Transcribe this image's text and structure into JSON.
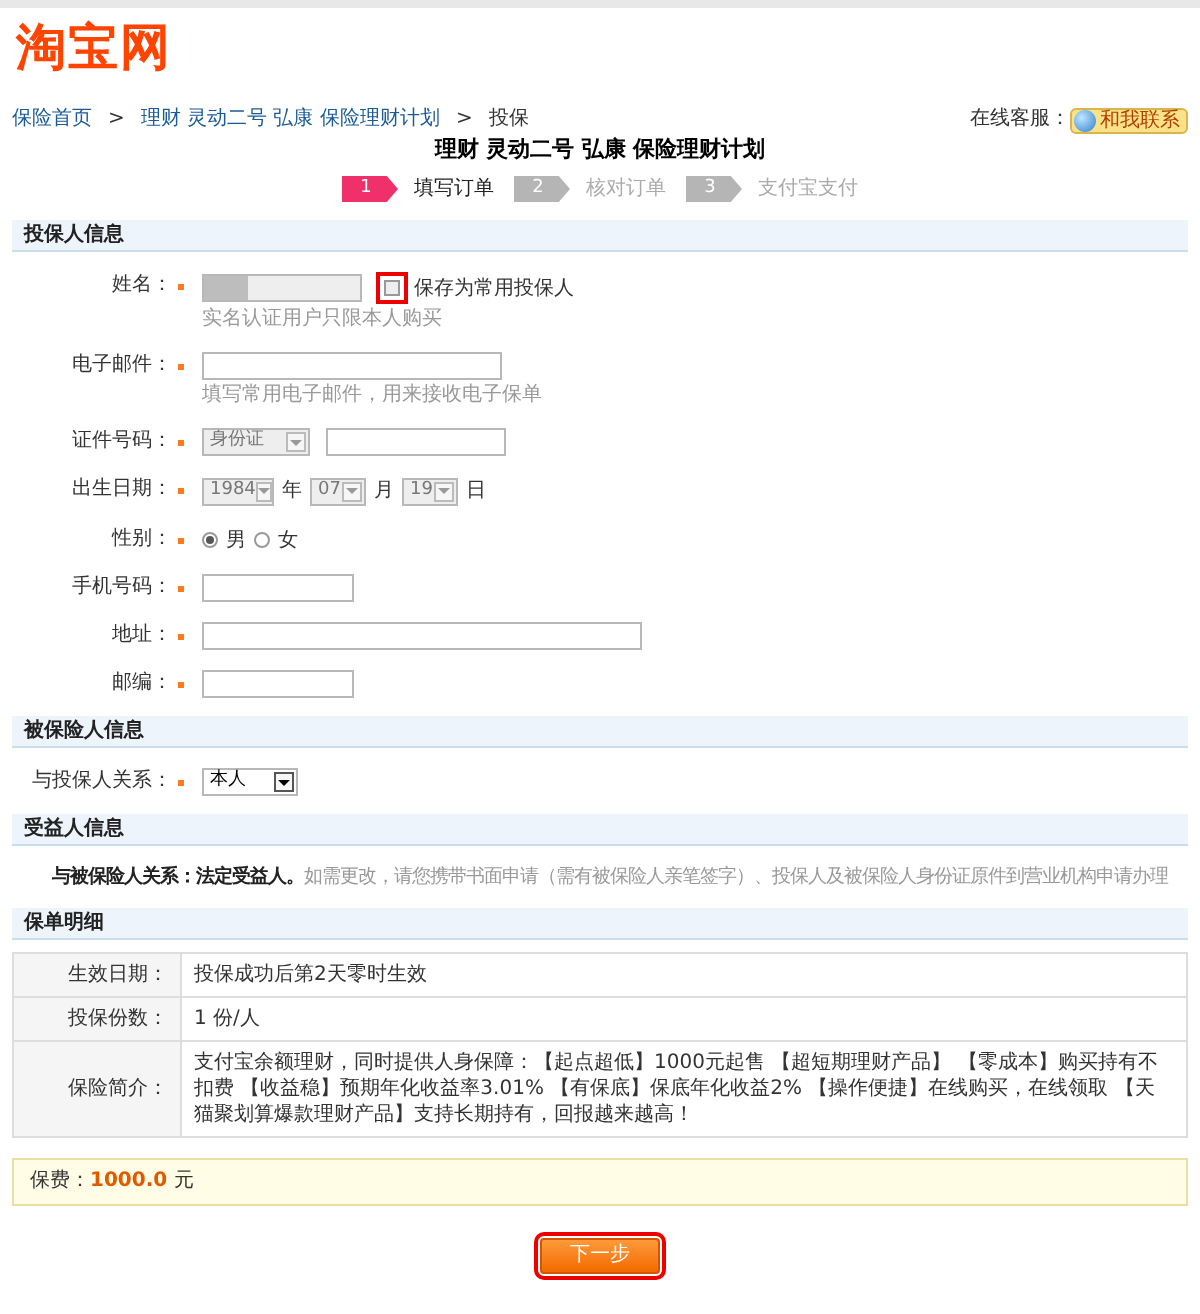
{
  "logo": "淘宝网",
  "breadcrumb": [
    {
      "kind": "link",
      "text": "保险首页"
    },
    {
      "kind": "sep",
      "text": ">"
    },
    {
      "kind": "link",
      "text": "理财 灵动二号 弘康 保险理财计划"
    },
    {
      "kind": "sep",
      "text": ">"
    },
    {
      "kind": "current",
      "text": "投保"
    }
  ],
  "service": {
    "label": "在线客服：",
    "button": "和我联系"
  },
  "title": "理财 灵动二号 弘康 保险理财计划",
  "steps": [
    {
      "number": "1",
      "label": "填写订单",
      "selected": true
    },
    {
      "number": "2",
      "label": "核对订单",
      "selected": false
    },
    {
      "number": "3",
      "label": "支付宝支付",
      "selected": false
    }
  ],
  "applicant": {
    "heading": "投保人信息",
    "fields": [
      {
        "kind": "name",
        "label": "姓名：",
        "required": true,
        "save_label": "保存为常用投保人",
        "save_checked": false,
        "highlighted": true,
        "hint": "实名认证用户只限本人购买"
      },
      {
        "kind": "email",
        "label": "电子邮件：",
        "required": true,
        "hint": "填写常用电子邮件，用来接收电子保单"
      },
      {
        "kind": "id",
        "label": "证件号码：",
        "required": true,
        "id_type": "身份证"
      },
      {
        "kind": "date",
        "label": "出生日期：",
        "required": true,
        "year": "1984",
        "year_unit": "年",
        "month": "07",
        "month_unit": "月",
        "day": "19",
        "day_unit": "日"
      },
      {
        "kind": "gender",
        "label": "性别：",
        "required": true,
        "options": [
          {
            "label": "男",
            "selected": true
          },
          {
            "label": "女",
            "selected": false
          }
        ]
      },
      {
        "kind": "phone",
        "label": "手机号码：",
        "required": true
      },
      {
        "kind": "address",
        "label": "地址：",
        "required": true
      },
      {
        "kind": "zip",
        "label": "邮编：",
        "required": true
      }
    ]
  },
  "insured": {
    "heading": "被保险人信息",
    "label": "与投保人关系：",
    "required": true,
    "value": "本人"
  },
  "beneficiary": {
    "heading": "受益人信息",
    "text": "**与被保险人关系：法定受益人。**如需更改，请您携带书面申请（需有被保险人亲笔签字）、投保人及被保险人身份证原件到营业机构申请办理"
  },
  "policy": {
    "heading": "保单明细",
    "rows": [
      {
        "label": "生效日期：",
        "value": "投保成功后第2天零时生效"
      },
      {
        "label": "投保份数：",
        "value": "1 份/人"
      },
      {
        "label": "保险简介：",
        "value": "支付宝余额理财，同时提供人身保障：【起点超低】1000元起售 【超短期理财产品】 【零成本】购买持有不扣费 【收益稳】预期年化收益率3.01% 【有保底】保底年化收益2% 【操作便捷】在线购买，在线领取 【天猫聚划算爆款理财产品】支持长期持有，回报越来越高！"
      }
    ]
  },
  "premium": {
    "label": "保费：",
    "amount": "1000.0",
    "unit": "元"
  },
  "next_button": {
    "label": "下一步",
    "highlighted": true
  }
}
